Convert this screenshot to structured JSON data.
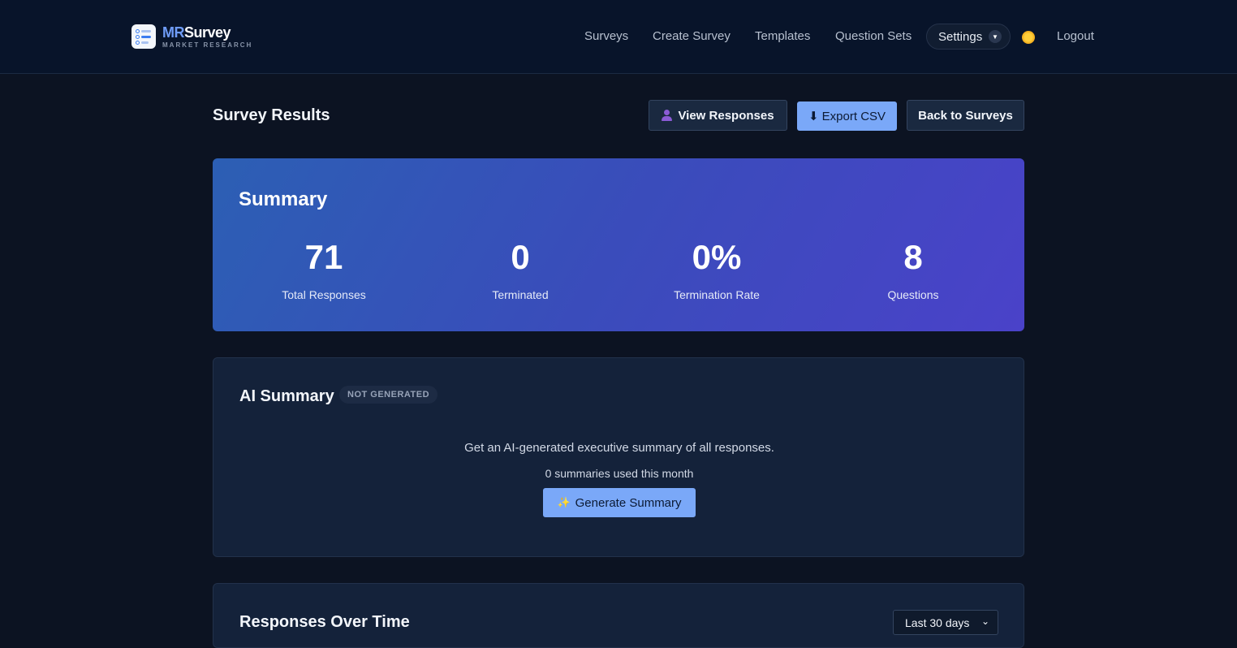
{
  "brand": {
    "name_prefix": "MR",
    "name_suffix": "Survey",
    "tagline": "MARKET RESEARCH"
  },
  "nav": {
    "items": [
      "Surveys",
      "Create Survey",
      "Templates",
      "Question Sets"
    ],
    "settings_label": "Settings",
    "theme_icon": "sun-icon",
    "logout_label": "Logout"
  },
  "page": {
    "title": "Survey Results",
    "actions": {
      "view_responses": "View Responses",
      "export_csv": "⬇ Export CSV",
      "back": "Back to Surveys"
    }
  },
  "summary": {
    "title": "Summary",
    "stats": [
      {
        "value": "71",
        "label": "Total Responses"
      },
      {
        "value": "0",
        "label": "Terminated"
      },
      {
        "value": "0%",
        "label": "Termination Rate"
      },
      {
        "value": "8",
        "label": "Questions"
      }
    ]
  },
  "ai_summary": {
    "title": "AI Summary",
    "status": "NOT GENERATED",
    "description": "Get an AI-generated executive summary of all responses.",
    "usage": "0 summaries used this month",
    "button": "Generate Summary"
  },
  "responses_over_time": {
    "title": "Responses Over Time",
    "range": "Last 30 days"
  },
  "colors": {
    "background": "#0c1322",
    "accent": "#7aa8f8",
    "summary_gradient_start": "#2c5fb4",
    "summary_gradient_end": "#4a42c9"
  }
}
